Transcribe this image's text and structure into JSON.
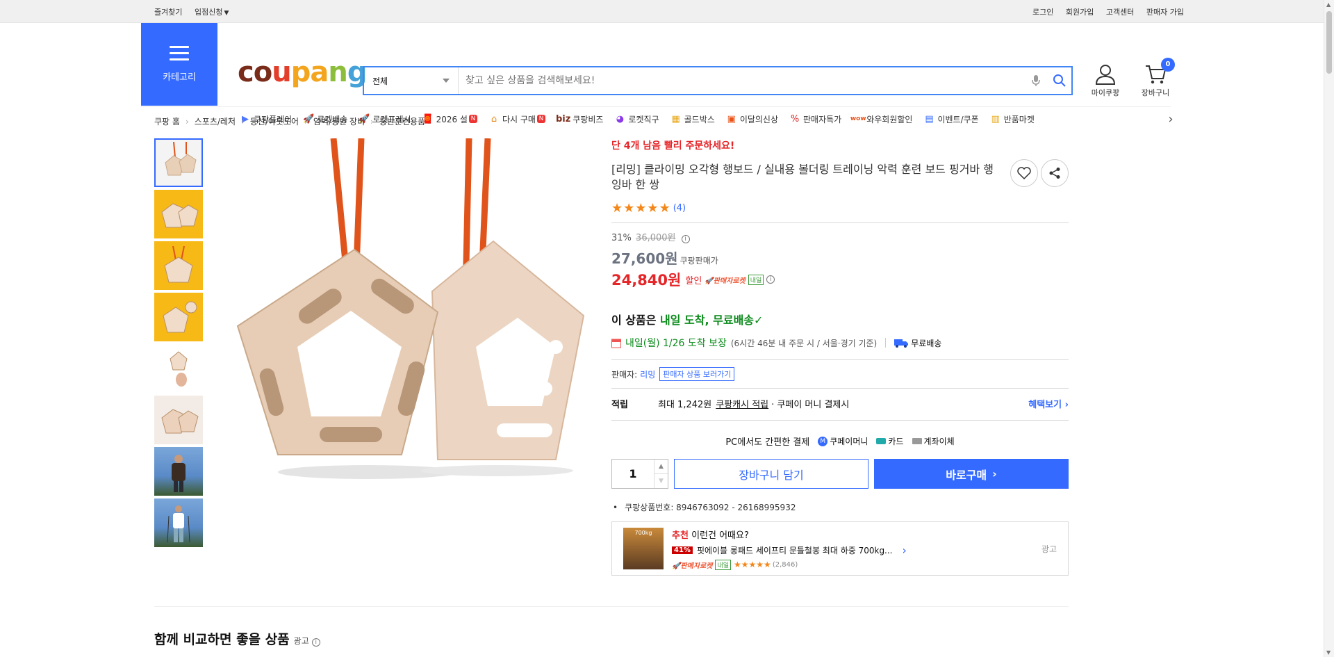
{
  "topbar": {
    "left": [
      "즐겨찾기",
      "입점신청"
    ],
    "right": [
      "로그인",
      "회원가입",
      "고객센터",
      "판매자 가입"
    ]
  },
  "header": {
    "category_label": "카테고리",
    "logo_text": "coupang",
    "search": {
      "category": "전체",
      "placeholder": "찾고 싶은 상품을 검색해보세요!"
    },
    "mycoupang_label": "마이쿠팡",
    "cart_label": "장바구니",
    "cart_count": "0"
  },
  "nav": {
    "items": [
      {
        "icon": "play-icon",
        "label": "쿠팡플레이"
      },
      {
        "icon": "rocket-icon",
        "label": "로켓배송"
      },
      {
        "icon": "rocket-fresh-icon",
        "label": "로켓프레시"
      },
      {
        "icon": "gift-icon",
        "label": "2026 설",
        "badge": "N"
      },
      {
        "icon": "house-icon",
        "label": "다시 구매",
        "badge": "N"
      },
      {
        "icon": "biz-icon",
        "label": "쿠팡비즈",
        "prefix": "biz"
      },
      {
        "icon": "global-icon",
        "label": "로켓직구"
      },
      {
        "icon": "gold-box-icon",
        "label": "골드박스"
      },
      {
        "icon": "bag-icon",
        "label": "이달의신상"
      },
      {
        "icon": "percent-icon",
        "label": "판매자특가"
      },
      {
        "icon": "wow-icon",
        "label": "와우회원할인"
      },
      {
        "icon": "coupon-icon",
        "label": "이벤트/쿠폰"
      },
      {
        "icon": "market-icon",
        "label": "반품마켓"
      }
    ]
  },
  "breadcrumb": [
    "쿠팡 홈",
    "스포츠/레저",
    "등산/아웃도어",
    "암벽/등반 장비",
    "등반훈련용품"
  ],
  "product": {
    "urgent": "단 4개 남음 빨리 주문하세요!",
    "title": "[리밍] 클라이밍 오각형 행보드 / 실내용 볼더링 트레이닝 악력 훈련 보드 핑거바 행잉바 한 쌍",
    "review_count": "(4)",
    "rating": 5,
    "discount_rate": "31%",
    "original_price": "36,000원",
    "coupang_price": "27,600원",
    "coupang_price_label": "쿠팡판매가",
    "final_price": "24,840원",
    "final_price_label": "할인",
    "rocket_label": "판매자로켓",
    "next_day_badge": "내일",
    "delivery_head_prefix": "이 상품은 ",
    "delivery_head_green": "내일 도착, 무료배송",
    "arrival_green": "내일(월) 1/26 도착 보장",
    "arrival_note": "(6시간 46분 내 주문 시 / 서울·경기 기준)",
    "free_shipping": "무료배송",
    "seller_label": "판매자:",
    "seller_name": "리밍",
    "seller_link": "판매자 상품 보러가기",
    "points_key": "적립",
    "points_text": "최대 1,242원",
    "points_underline": "쿠팡캐시 적립",
    "points_suffix": "· 쿠페이 머니 결제시",
    "points_more": "혜택보기",
    "pay_title": "PC에서도 간편한 결제",
    "pay_methods": [
      "쿠페이머니",
      "카드",
      "계좌이체"
    ],
    "quantity": "1",
    "cart_button": "장바구니 담기",
    "buy_button": "바로구매",
    "product_id": "쿠팡상품번호: 8946763092 - 26168995932"
  },
  "recommend": {
    "label_red": "추천",
    "label": "이런건 어때요?",
    "discount": "41%",
    "name": "핏에이블 롱패드 세이프티 문틀철봉 최대 하중 700kg...",
    "rocket_label": "판매자로켓",
    "next_day_badge": "내일",
    "review_count": "(2,846)",
    "ad_label": "광고",
    "image_text": "700kg"
  },
  "compare": {
    "title": "함께 비교하면 좋을 상품",
    "ad_label": "광고"
  },
  "colors": {
    "accent": "#346aff",
    "price_red": "#e52528",
    "green": "#0a8a1a",
    "star": "#f3871a"
  }
}
